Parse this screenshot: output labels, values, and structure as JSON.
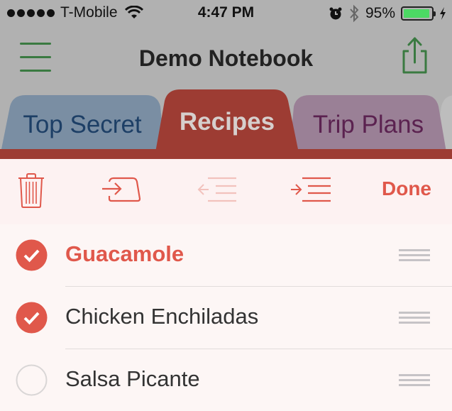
{
  "status_bar": {
    "signal_dots": 5,
    "carrier": "T-Mobile",
    "time": "4:47 PM",
    "battery_percent_label": "95%",
    "battery_level": 0.95,
    "icons": [
      "wifi-icon",
      "alarm-icon",
      "bluetooth-icon",
      "battery-icon",
      "charging-bolt-icon"
    ]
  },
  "nav": {
    "title": "Demo Notebook",
    "menu_icon": "hamburger-menu-icon",
    "share_icon": "share-icon"
  },
  "tabs": [
    {
      "label": "Top Secret",
      "color": "#7a8ea3",
      "text_color": "#1d3f66",
      "active": false
    },
    {
      "label": "Recipes",
      "color": "#9d3c33",
      "text_color": "#d6cfcd",
      "active": true
    },
    {
      "label": "Trip Plans",
      "color": "#9a8096",
      "text_color": "#5b2250",
      "active": false
    }
  ],
  "toolbar": {
    "items": [
      {
        "icon": "trash-icon",
        "enabled": true
      },
      {
        "icon": "move-to-icon",
        "enabled": true
      },
      {
        "icon": "outdent-icon",
        "enabled": false
      },
      {
        "icon": "indent-icon",
        "enabled": true
      }
    ],
    "done_label": "Done",
    "accent": "#e0584b"
  },
  "list": {
    "items": [
      {
        "title": "Guacamole",
        "checked": true,
        "active": true
      },
      {
        "title": "Chicken Enchiladas",
        "checked": true,
        "active": false
      },
      {
        "title": "Salsa Picante",
        "checked": false,
        "active": false
      }
    ]
  },
  "colors": {
    "accent": "#e0584b",
    "nav_green": "#3a7a41",
    "overlay_gray": "#b1b1b1",
    "list_bg": "#fdf6f5"
  }
}
